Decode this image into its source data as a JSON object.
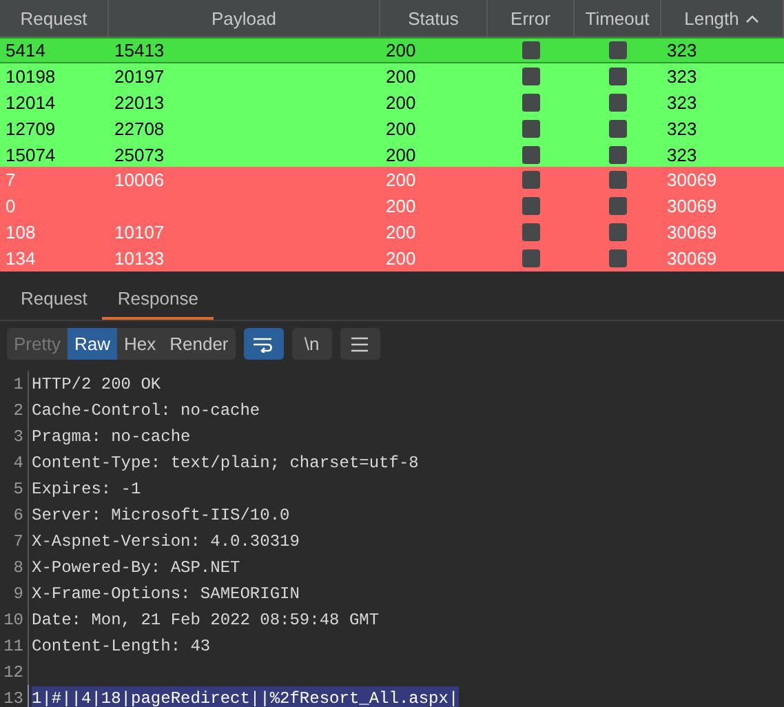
{
  "table": {
    "columns": [
      {
        "label": "Request",
        "sorted": false
      },
      {
        "label": "Payload",
        "sorted": false
      },
      {
        "label": "Status",
        "sorted": false
      },
      {
        "label": "Error",
        "sorted": false
      },
      {
        "label": "Timeout",
        "sorted": false
      },
      {
        "label": "Length",
        "sorted": true
      }
    ],
    "rows": [
      {
        "request": "5414",
        "payload": "15413",
        "status": "200",
        "error": false,
        "timeout": false,
        "length": "323",
        "color": "#44e044",
        "selected": true
      },
      {
        "request": "10198",
        "payload": "20197",
        "status": "200",
        "error": false,
        "timeout": false,
        "length": "323",
        "color": "#66ff66",
        "selected": false
      },
      {
        "request": "12014",
        "payload": "22013",
        "status": "200",
        "error": false,
        "timeout": false,
        "length": "323",
        "color": "#66ff66",
        "selected": false
      },
      {
        "request": "12709",
        "payload": "22708",
        "status": "200",
        "error": false,
        "timeout": false,
        "length": "323",
        "color": "#66ff66",
        "selected": false
      },
      {
        "request": "15074",
        "payload": "25073",
        "status": "200",
        "error": false,
        "timeout": false,
        "length": "323",
        "color": "#66ff66",
        "selected": false
      },
      {
        "request": "7",
        "payload": "10006",
        "status": "200",
        "error": false,
        "timeout": false,
        "length": "30069",
        "color": "#ff6464",
        "selected": false
      },
      {
        "request": "0",
        "status": "200",
        "error": false,
        "timeout": false,
        "length": "30069",
        "color": "#ff6464",
        "selected": false
      },
      {
        "request": "108",
        "payload": "10107",
        "status": "200",
        "error": false,
        "timeout": false,
        "length": "30069",
        "color": "#ff6464",
        "selected": false
      },
      {
        "request": "134",
        "payload": "10133",
        "status": "200",
        "error": false,
        "timeout": false,
        "length": "30069",
        "color": "#ff6464",
        "selected": false
      }
    ]
  },
  "tabs": [
    {
      "label": "Request",
      "selected": false
    },
    {
      "label": "Response",
      "selected": true
    }
  ],
  "view_modes": [
    {
      "label": "Pretty",
      "selected": false,
      "disabled": true
    },
    {
      "label": "Raw",
      "selected": true,
      "disabled": false
    },
    {
      "label": "Hex",
      "selected": false,
      "disabled": false
    },
    {
      "label": "Render",
      "selected": false,
      "disabled": false
    }
  ],
  "toolbar": {
    "wrap_on": true,
    "newline_label": "\\n",
    "newline_on": false
  },
  "editor": {
    "lines": [
      {
        "number": "1",
        "text": "HTTP/2 200 OK",
        "selected": false
      },
      {
        "number": "2",
        "text": "Cache-Control: no-cache",
        "selected": false
      },
      {
        "number": "3",
        "text": "Pragma: no-cache",
        "selected": false
      },
      {
        "number": "4",
        "text": "Content-Type: text/plain; charset=utf-8",
        "selected": false
      },
      {
        "number": "5",
        "text": "Expires: -1",
        "selected": false
      },
      {
        "number": "6",
        "text": "Server: Microsoft-IIS/10.0",
        "selected": false
      },
      {
        "number": "7",
        "text": "X-Aspnet-Version: 4.0.30319",
        "selected": false
      },
      {
        "number": "8",
        "text": "X-Powered-By: ASP.NET",
        "selected": false
      },
      {
        "number": "9",
        "text": "X-Frame-Options: SAMEORIGIN",
        "selected": false
      },
      {
        "number": "10",
        "text": "Date: Mon, 21 Feb 2022 08:59:48 GMT",
        "selected": false
      },
      {
        "number": "11",
        "text": "Content-Length: 43",
        "selected": false
      },
      {
        "number": "12",
        "selected": false
      },
      {
        "number": "13",
        "text": "1|#||4|18|pageRedirect||%2fResort_All.aspx|",
        "selected": true
      }
    ]
  }
}
